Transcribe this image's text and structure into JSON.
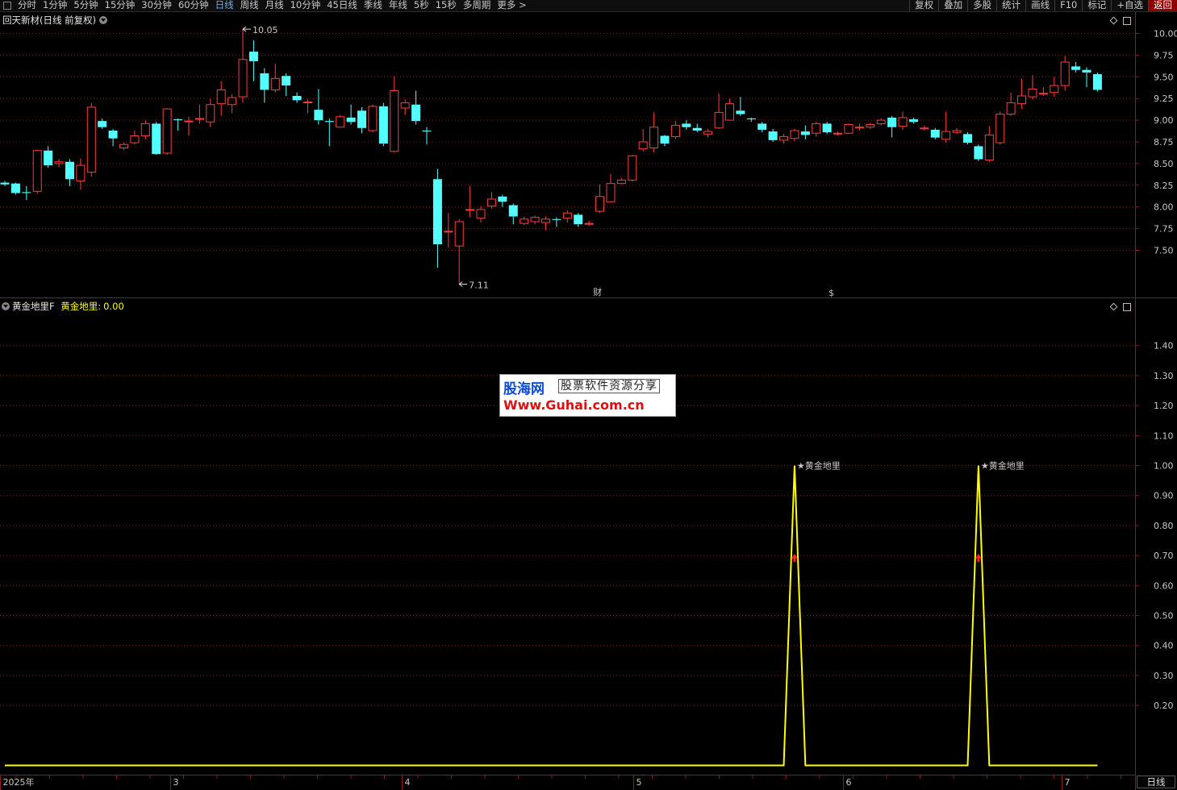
{
  "toolbar": {
    "tabs": [
      "分时",
      "1分钟",
      "5分钟",
      "15分钟",
      "30分钟",
      "60分钟",
      "日线",
      "周线",
      "月线",
      "10分钟",
      "45日线",
      "季线",
      "年线",
      "5秒",
      "15秒",
      "多周期",
      "更多 >"
    ],
    "active_tab": "日线",
    "right_buttons": [
      "复权",
      "叠加",
      "多股",
      "统计",
      "画线",
      "F10",
      "标记",
      "+自选",
      "返回"
    ]
  },
  "main_pane": {
    "title": "回天新材(日线 前复权)",
    "high_label": "10.05",
    "low_label": "7.11",
    "marker_finance": "财",
    "marker_dividend": "$"
  },
  "indicator_pane": {
    "title": "黄金地里F",
    "value_name": "黄金地里",
    "value_sep": ":",
    "value": "0.00",
    "signal_label_1": "★黄金地里",
    "signal_label_2": "★黄金地里"
  },
  "watermark": {
    "logo": "股海网",
    "slogan": "股票软件资源分享",
    "url": "Www.Guhai.com.cn"
  },
  "period_box": "日线",
  "colors": {
    "up": "#ff3c3c",
    "down": "#54ffff",
    "indicator_line": "#ffff00",
    "grid": "#7a1a1a",
    "signal_text": "#ff2020"
  },
  "chart_data": [
    {
      "type": "candlestick",
      "title": "回天新材(日线 前复权)",
      "y_ticks": [
        "10.00",
        "9.75",
        "9.50",
        "9.25",
        "9.00",
        "8.75",
        "8.50",
        "8.25",
        "8.00",
        "7.75",
        "7.50"
      ],
      "ylim": [
        7.0,
        10.05
      ],
      "x_ticks": [
        "2025年",
        "3",
        "4",
        "5",
        "6",
        "7"
      ],
      "annotations": {
        "high": 10.05,
        "low": 7.11
      },
      "candles": [
        {
          "o": 8.28,
          "c": 8.26,
          "h": 8.3,
          "l": 8.24
        },
        {
          "o": 8.27,
          "c": 8.16,
          "h": 8.28,
          "l": 8.14
        },
        {
          "o": 8.17,
          "c": 8.16,
          "h": 8.24,
          "l": 8.08
        },
        {
          "o": 8.18,
          "c": 8.65,
          "h": 8.66,
          "l": 8.15
        },
        {
          "o": 8.65,
          "c": 8.48,
          "h": 8.7,
          "l": 8.45
        },
        {
          "o": 8.5,
          "c": 8.52,
          "h": 8.55,
          "l": 8.46
        },
        {
          "o": 8.52,
          "c": 8.32,
          "h": 8.55,
          "l": 8.24
        },
        {
          "o": 8.3,
          "c": 8.48,
          "h": 8.56,
          "l": 8.2
        },
        {
          "o": 8.4,
          "c": 9.15,
          "h": 9.2,
          "l": 8.35
        },
        {
          "o": 8.99,
          "c": 8.92,
          "h": 9.02,
          "l": 8.9
        },
        {
          "o": 8.88,
          "c": 8.79,
          "h": 8.9,
          "l": 8.7
        },
        {
          "o": 8.68,
          "c": 8.72,
          "h": 8.74,
          "l": 8.66
        },
        {
          "o": 8.74,
          "c": 8.82,
          "h": 8.88,
          "l": 8.72
        },
        {
          "o": 8.82,
          "c": 8.96,
          "h": 9.0,
          "l": 8.78
        },
        {
          "o": 8.96,
          "c": 8.61,
          "h": 8.98,
          "l": 8.6
        },
        {
          "o": 8.62,
          "c": 9.13,
          "h": 9.14,
          "l": 8.6
        },
        {
          "o": 9.01,
          "c": 9.0,
          "h": 9.02,
          "l": 8.88
        },
        {
          "o": 8.99,
          "c": 8.99,
          "h": 9.04,
          "l": 8.82
        },
        {
          "o": 9.01,
          "c": 9.02,
          "h": 9.18,
          "l": 8.96
        },
        {
          "o": 8.98,
          "c": 9.18,
          "h": 9.25,
          "l": 8.92
        },
        {
          "o": 9.19,
          "c": 9.35,
          "h": 9.45,
          "l": 9.05
        },
        {
          "o": 9.18,
          "c": 9.26,
          "h": 9.3,
          "l": 9.08
        },
        {
          "o": 9.27,
          "c": 9.7,
          "h": 10.05,
          "l": 9.2
        },
        {
          "o": 9.79,
          "c": 9.68,
          "h": 9.92,
          "l": 9.45
        },
        {
          "o": 9.54,
          "c": 9.35,
          "h": 9.6,
          "l": 9.2
        },
        {
          "o": 9.35,
          "c": 9.48,
          "h": 9.65,
          "l": 9.32
        },
        {
          "o": 9.51,
          "c": 9.4,
          "h": 9.54,
          "l": 9.28
        },
        {
          "o": 9.28,
          "c": 9.23,
          "h": 9.32,
          "l": 9.2
        },
        {
          "o": 9.2,
          "c": 9.21,
          "h": 9.24,
          "l": 9.08
        },
        {
          "o": 9.12,
          "c": 9.0,
          "h": 9.36,
          "l": 8.95
        },
        {
          "o": 8.99,
          "c": 8.98,
          "h": 9.02,
          "l": 8.7
        },
        {
          "o": 8.92,
          "c": 9.04,
          "h": 9.06,
          "l": 8.92
        },
        {
          "o": 9.03,
          "c": 8.98,
          "h": 9.18,
          "l": 8.95
        },
        {
          "o": 9.11,
          "c": 8.91,
          "h": 9.15,
          "l": 8.85
        },
        {
          "o": 8.88,
          "c": 9.16,
          "h": 9.18,
          "l": 8.86
        },
        {
          "o": 9.16,
          "c": 8.73,
          "h": 9.2,
          "l": 8.7
        },
        {
          "o": 8.64,
          "c": 9.34,
          "h": 9.51,
          "l": 8.63
        },
        {
          "o": 9.14,
          "c": 9.2,
          "h": 9.24,
          "l": 9.06
        },
        {
          "o": 9.18,
          "c": 8.99,
          "h": 9.34,
          "l": 8.95
        },
        {
          "o": 8.88,
          "c": 8.87,
          "h": 8.92,
          "l": 8.72
        },
        {
          "o": 8.32,
          "c": 7.57,
          "h": 8.44,
          "l": 7.3
        },
        {
          "o": 7.71,
          "c": 7.72,
          "h": 7.93,
          "l": 7.53
        },
        {
          "o": 7.55,
          "c": 7.83,
          "h": 7.86,
          "l": 7.11
        },
        {
          "o": 7.97,
          "c": 7.97,
          "h": 8.24,
          "l": 7.88
        },
        {
          "o": 7.87,
          "c": 7.97,
          "h": 8.01,
          "l": 7.82
        },
        {
          "o": 8.01,
          "c": 8.09,
          "h": 8.17,
          "l": 7.98
        },
        {
          "o": 8.12,
          "c": 8.06,
          "h": 8.14,
          "l": 8.0
        },
        {
          "o": 8.02,
          "c": 7.89,
          "h": 8.04,
          "l": 7.8
        },
        {
          "o": 7.81,
          "c": 7.86,
          "h": 7.89,
          "l": 7.79
        },
        {
          "o": 7.83,
          "c": 7.88,
          "h": 7.9,
          "l": 7.8
        },
        {
          "o": 7.82,
          "c": 7.86,
          "h": 7.89,
          "l": 7.73
        },
        {
          "o": 7.86,
          "c": 7.85,
          "h": 7.88,
          "l": 7.77
        },
        {
          "o": 7.87,
          "c": 7.93,
          "h": 7.96,
          "l": 7.82
        },
        {
          "o": 7.91,
          "c": 7.8,
          "h": 7.93,
          "l": 7.77
        },
        {
          "o": 7.81,
          "c": 7.81,
          "h": 7.84,
          "l": 7.78
        },
        {
          "o": 7.95,
          "c": 8.12,
          "h": 8.26,
          "l": 7.93
        },
        {
          "o": 8.06,
          "c": 8.27,
          "h": 8.38,
          "l": 8.05
        },
        {
          "o": 8.27,
          "c": 8.31,
          "h": 8.33,
          "l": 8.26
        },
        {
          "o": 8.31,
          "c": 8.59,
          "h": 8.6,
          "l": 8.29
        },
        {
          "o": 8.67,
          "c": 8.75,
          "h": 8.9,
          "l": 8.64
        },
        {
          "o": 8.68,
          "c": 8.92,
          "h": 9.09,
          "l": 8.63
        },
        {
          "o": 8.82,
          "c": 8.73,
          "h": 8.83,
          "l": 8.7
        },
        {
          "o": 8.81,
          "c": 8.94,
          "h": 8.99,
          "l": 8.78
        },
        {
          "o": 8.96,
          "c": 8.92,
          "h": 9.0,
          "l": 8.89
        },
        {
          "o": 8.91,
          "c": 8.88,
          "h": 8.96,
          "l": 8.86
        },
        {
          "o": 8.84,
          "c": 8.87,
          "h": 8.9,
          "l": 8.8
        },
        {
          "o": 8.91,
          "c": 9.09,
          "h": 9.31,
          "l": 8.9
        },
        {
          "o": 9.0,
          "c": 9.19,
          "h": 9.25,
          "l": 9.0
        },
        {
          "o": 9.11,
          "c": 9.07,
          "h": 9.27,
          "l": 9.05
        },
        {
          "o": 9.02,
          "c": 9.01,
          "h": 9.03,
          "l": 8.98
        },
        {
          "o": 8.96,
          "c": 8.89,
          "h": 8.98,
          "l": 8.86
        },
        {
          "o": 8.87,
          "c": 8.77,
          "h": 8.9,
          "l": 8.75
        },
        {
          "o": 8.77,
          "c": 8.81,
          "h": 8.84,
          "l": 8.73
        },
        {
          "o": 8.79,
          "c": 8.88,
          "h": 8.9,
          "l": 8.76
        },
        {
          "o": 8.87,
          "c": 8.83,
          "h": 8.94,
          "l": 8.78
        },
        {
          "o": 8.85,
          "c": 8.96,
          "h": 8.98,
          "l": 8.81
        },
        {
          "o": 8.96,
          "c": 8.86,
          "h": 8.98,
          "l": 8.84
        },
        {
          "o": 8.84,
          "c": 8.85,
          "h": 8.87,
          "l": 8.82
        },
        {
          "o": 8.85,
          "c": 8.95,
          "h": 8.96,
          "l": 8.84
        },
        {
          "o": 8.91,
          "c": 8.92,
          "h": 8.96,
          "l": 8.88
        },
        {
          "o": 8.92,
          "c": 8.95,
          "h": 8.97,
          "l": 8.9
        },
        {
          "o": 8.96,
          "c": 9.0,
          "h": 9.02,
          "l": 8.94
        },
        {
          "o": 9.03,
          "c": 8.92,
          "h": 9.05,
          "l": 8.8
        },
        {
          "o": 8.93,
          "c": 9.03,
          "h": 9.1,
          "l": 8.89
        },
        {
          "o": 9.01,
          "c": 8.98,
          "h": 9.03,
          "l": 8.96
        },
        {
          "o": 8.9,
          "c": 8.91,
          "h": 8.94,
          "l": 8.88
        },
        {
          "o": 8.89,
          "c": 8.8,
          "h": 8.91,
          "l": 8.78
        },
        {
          "o": 8.78,
          "c": 8.87,
          "h": 9.1,
          "l": 8.74
        },
        {
          "o": 8.86,
          "c": 8.88,
          "h": 8.91,
          "l": 8.84
        },
        {
          "o": 8.84,
          "c": 8.74,
          "h": 8.86,
          "l": 8.72
        },
        {
          "o": 8.7,
          "c": 8.55,
          "h": 8.72,
          "l": 8.53
        },
        {
          "o": 8.54,
          "c": 8.83,
          "h": 8.93,
          "l": 8.52
        },
        {
          "o": 8.74,
          "c": 9.07,
          "h": 9.1,
          "l": 8.72
        },
        {
          "o": 9.07,
          "c": 9.2,
          "h": 9.32,
          "l": 9.05
        },
        {
          "o": 9.19,
          "c": 9.28,
          "h": 9.48,
          "l": 9.13
        },
        {
          "o": 9.27,
          "c": 9.36,
          "h": 9.52,
          "l": 9.24
        },
        {
          "o": 9.3,
          "c": 9.31,
          "h": 9.38,
          "l": 9.28
        },
        {
          "o": 9.32,
          "c": 9.4,
          "h": 9.5,
          "l": 9.27
        },
        {
          "o": 9.4,
          "c": 9.67,
          "h": 9.74,
          "l": 9.34
        },
        {
          "o": 9.62,
          "c": 9.58,
          "h": 9.67,
          "l": 9.55
        },
        {
          "o": 9.58,
          "c": 9.55,
          "h": 9.61,
          "l": 9.38
        },
        {
          "o": 9.53,
          "c": 9.35,
          "h": 9.55,
          "l": 9.33
        }
      ]
    },
    {
      "type": "line",
      "name": "黄金地里",
      "y_ticks": [
        "1.40",
        "1.30",
        "1.20",
        "1.10",
        "1.00",
        "0.90",
        "0.80",
        "0.70",
        "0.60",
        "0.50",
        "0.40",
        "0.30",
        "0.20"
      ],
      "ylim": [
        -0.02,
        1.5
      ],
      "baseline": 0,
      "signal_bars": [
        73,
        90
      ],
      "signal_value": 1.0,
      "arrow_value": 0.69
    }
  ]
}
